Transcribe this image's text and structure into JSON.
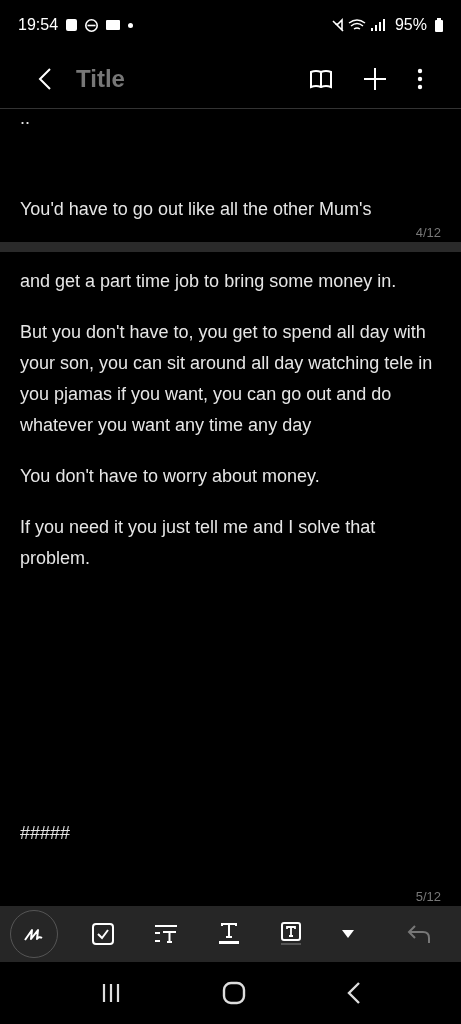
{
  "status_bar": {
    "time": "19:54",
    "battery": "95%"
  },
  "app_bar": {
    "title": "Title"
  },
  "pages": [
    {
      "paragraphs": [
        "..",
        "You'd have to go out like all the other Mum's"
      ],
      "page_number": "4/12"
    },
    {
      "paragraphs": [
        "and get a part time job to bring some money in.",
        "But you don't have to, you get to spend all day with your son, you can sit around all day watching tele in you pjamas if you want, you can go out and do whatever you want any time any day",
        "You don't have to worry about money.",
        "If you need it you just tell me and I solve that problem.",
        "#####"
      ],
      "page_number": "5/12"
    }
  ],
  "toolbar": [
    {
      "kind": "pen"
    },
    {
      "kind": "checkbox"
    },
    {
      "kind": "text-style"
    },
    {
      "kind": "underline"
    },
    {
      "kind": "text-box"
    },
    {
      "kind": "more"
    },
    {
      "kind": "undo",
      "disabled": true
    }
  ]
}
